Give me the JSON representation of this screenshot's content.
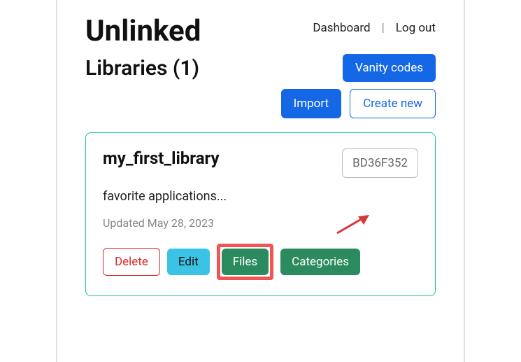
{
  "header": {
    "brand": "Unlinked",
    "nav": {
      "dashboard": "Dashboard",
      "logout": "Log out"
    }
  },
  "subtitle": "Libraries (1)",
  "actions": {
    "vanity_codes": "Vanity codes",
    "import": "Import",
    "create_new": "Create new"
  },
  "library": {
    "title": "my_first_library",
    "code": "BD36F352",
    "description": "favorite applications...",
    "updated": "Updated May 28, 2023",
    "buttons": {
      "delete": "Delete",
      "edit": "Edit",
      "files": "Files",
      "categories": "Categories"
    }
  }
}
